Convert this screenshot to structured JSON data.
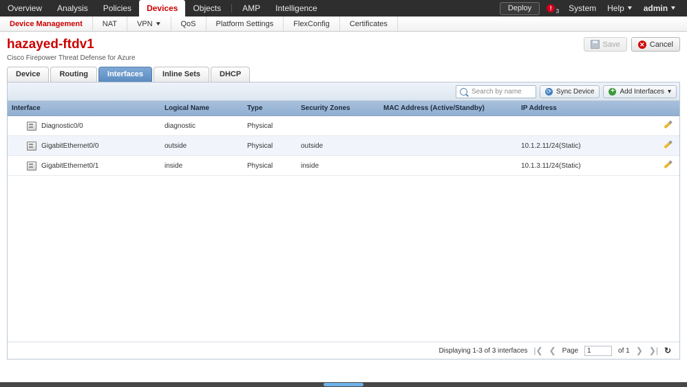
{
  "topnav": {
    "items": [
      {
        "label": "Overview",
        "active": false
      },
      {
        "label": "Analysis",
        "active": false
      },
      {
        "label": "Policies",
        "active": false
      },
      {
        "label": "Devices",
        "active": true
      },
      {
        "label": "Objects",
        "active": false
      },
      {
        "label": "AMP",
        "active": false
      },
      {
        "label": "Intelligence",
        "active": false
      }
    ],
    "deploy_label": "Deploy",
    "notification_icon": "alert-exclamation-icon",
    "notification_symbol": "!",
    "notification_count": "3",
    "system_label": "System",
    "help_label": "Help",
    "user_label": "admin",
    "caret": "▼"
  },
  "subnav": {
    "items": [
      {
        "label": "Device Management",
        "active": true,
        "caret": ""
      },
      {
        "label": "NAT",
        "active": false,
        "caret": ""
      },
      {
        "label": "VPN",
        "active": false,
        "caret": "▼"
      },
      {
        "label": "QoS",
        "active": false,
        "caret": ""
      },
      {
        "label": "Platform Settings",
        "active": false,
        "caret": ""
      },
      {
        "label": "FlexConfig",
        "active": false,
        "caret": ""
      },
      {
        "label": "Certificates",
        "active": false,
        "caret": ""
      }
    ]
  },
  "header": {
    "title": "hazayed-ftdv1",
    "subtitle": "Cisco Firepower Threat Defense for Azure",
    "save_label": "Save",
    "save_icon": "floppy-disk-icon",
    "save_disabled": true,
    "cancel_label": "Cancel",
    "cancel_icon": "red-x-circle-icon",
    "cancel_symbol": "✕"
  },
  "device_tabs": [
    {
      "label": "Device",
      "active": false
    },
    {
      "label": "Routing",
      "active": false
    },
    {
      "label": "Interfaces",
      "active": true
    },
    {
      "label": "Inline Sets",
      "active": false
    },
    {
      "label": "DHCP",
      "active": false
    }
  ],
  "toolbar": {
    "search_placeholder": "Search by name",
    "search_value": "",
    "search_icon": "magnifier-icon",
    "sync_label": "Sync Device",
    "sync_icon": "refresh-circle-icon",
    "sync_symbol": "⟳",
    "add_label": "Add Interfaces",
    "add_icon": "green-plus-circle-icon",
    "add_symbol": "+",
    "add_caret": "▾"
  },
  "table": {
    "columns": [
      "Interface",
      "Logical Name",
      "Type",
      "Security Zones",
      "MAC Address (Active/Standby)",
      "IP Address",
      ""
    ],
    "rows": [
      {
        "icon": "interface-port-icon",
        "interface": "Diagnostic0/0",
        "logical_name": "diagnostic",
        "type": "Physical",
        "security_zones": "",
        "mac_address": "",
        "ip_address": "",
        "edit_icon": "pencil-edit-icon"
      },
      {
        "icon": "interface-port-icon",
        "interface": "GigabitEthernet0/0",
        "logical_name": "outside",
        "type": "Physical",
        "security_zones": "outside",
        "mac_address": "",
        "ip_address": "10.1.2.11/24(Static)",
        "edit_icon": "pencil-edit-icon"
      },
      {
        "icon": "interface-port-icon",
        "interface": "GigabitEthernet0/1",
        "logical_name": "inside",
        "type": "Physical",
        "security_zones": "inside",
        "mac_address": "",
        "ip_address": "10.1.3.11/24(Static)",
        "edit_icon": "pencil-edit-icon"
      }
    ]
  },
  "pager": {
    "status": "Displaying 1-3 of 3 interfaces",
    "first_icon": "first-page-icon",
    "first_symbol": "|❮",
    "prev_icon": "prev-page-icon",
    "prev_symbol": "❮",
    "page_label": "Page",
    "page_value": "1",
    "of_label": "of 1",
    "next_icon": "next-page-icon",
    "next_symbol": "❯",
    "last_icon": "last-page-icon",
    "last_symbol": "❯|",
    "refresh_icon": "refresh-icon",
    "refresh_symbol": "↻"
  },
  "colors": {
    "brand_red": "#cc0000",
    "topnav_bg": "#2e2e2e",
    "active_tab_blue": "#5b8cc0",
    "table_header_blue": "#91afd2",
    "alt_row": "#f1f5fb",
    "notification_red": "#d0021b",
    "scrollbar_thumb": "#6fb2e8"
  }
}
